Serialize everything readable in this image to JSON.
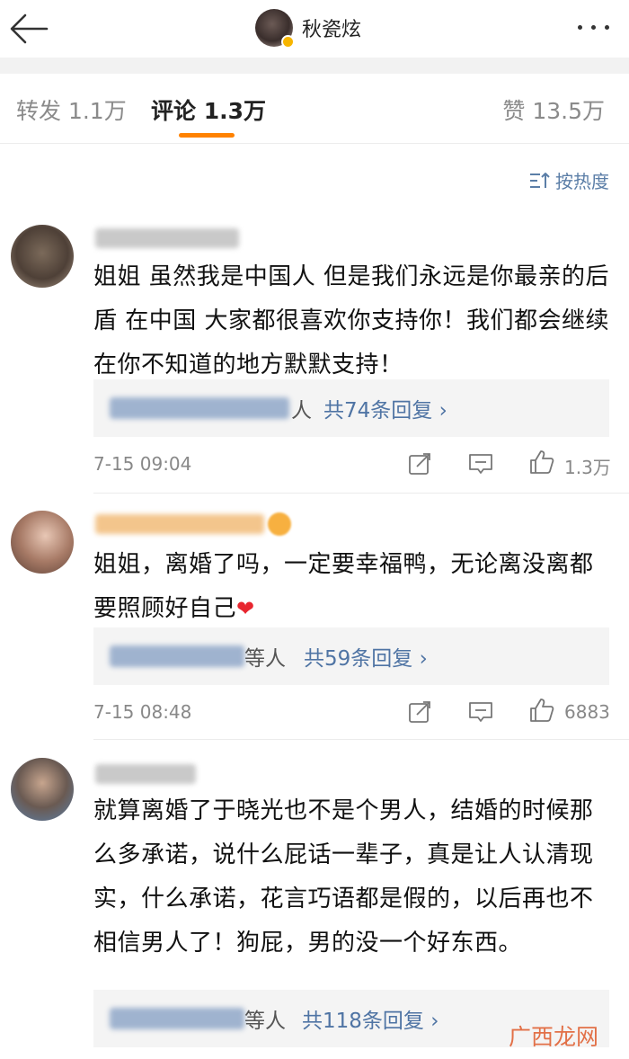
{
  "header": {
    "title": "秋瓷炫"
  },
  "tabs": {
    "repost": "转发 1.1万",
    "comment": "评论 1.3万",
    "like": "赞 13.5万"
  },
  "sort": {
    "label": "按热度"
  },
  "comments": [
    {
      "text": "姐姐 虽然我是中国人 但是我们永远是你最亲的后盾 在中国 大家都很喜欢你支持你！我们都会继续在你不知道的地方默默支持！",
      "reply_suffix": "人",
      "reply_count": "共74条回复 ›",
      "time": "7-15 09:04",
      "likes": "1.3万"
    },
    {
      "text": "姐姐，离婚了吗，一定要幸福鸭，无论离没离都要照顾好自己",
      "heart": "❤",
      "reply_suffix": "等人",
      "reply_count": "共59条回复 ›",
      "time": "7-15 08:48",
      "likes": "6883"
    },
    {
      "text": "就算离婚了于晓光也不是个男人，结婚的时候那么多承诺，说什么屁话一辈子，真是让人认清现实，什么承诺，花言巧语都是假的，以后再也不相信男人了！狗屁，男的没一个好东西。",
      "reply_suffix": "等人",
      "reply_count": "共118条回复 ›"
    }
  ],
  "watermark": "广西龙网",
  "colors": {
    "accent": "#ff8200",
    "link": "#4f74a4",
    "verify": "#f7b500"
  }
}
